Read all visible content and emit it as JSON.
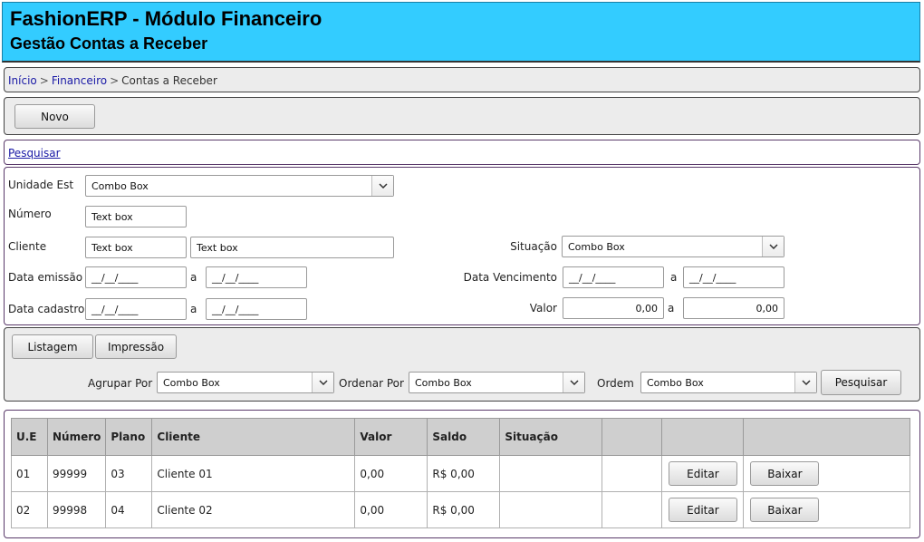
{
  "header": {
    "title": "FashionERP - Módulo Financeiro",
    "subtitle": "Gestão Contas a Receber"
  },
  "breadcrumb": {
    "items": [
      {
        "label": "Início",
        "link": true
      },
      {
        "label": "Financeiro",
        "link": true
      },
      {
        "label": "Contas a Receber",
        "link": false
      }
    ],
    "separator": ">"
  },
  "toolbar": {
    "new_label": "Novo"
  },
  "search_toggle": {
    "label": "Pesquisar"
  },
  "filters": {
    "unidade": {
      "label": "Unidade Est",
      "value": "Combo Box"
    },
    "numero": {
      "label": "Número",
      "value": "Text box"
    },
    "cliente": {
      "label": "Cliente",
      "code_value": "Text box",
      "name_value": "Text box"
    },
    "situacao": {
      "label": "Situação",
      "value": "Combo Box"
    },
    "data_emissao": {
      "label": "Data emissão",
      "from": "__/__/____",
      "sep": "a",
      "to": "__/__/____"
    },
    "data_vencimento": {
      "label": "Data Vencimento",
      "from": "__/__/____",
      "sep": "a",
      "to": "__/__/____"
    },
    "data_cadastro": {
      "label": "Data cadastro",
      "from": "__/__/____",
      "sep": "a",
      "to": "__/__/____"
    },
    "valor": {
      "label": "Valor",
      "from": "0,00",
      "sep": "a",
      "to": "0,00"
    }
  },
  "actions": {
    "listagem_label": "Listagem",
    "impressao_label": "Impressão",
    "agrupar": {
      "label": "Agrupar Por",
      "value": "Combo Box"
    },
    "ordenar": {
      "label": "Ordenar Por",
      "value": "Combo Box"
    },
    "ordem": {
      "label": "Ordem",
      "value": "Combo Box"
    },
    "search_label": "Pesquisar"
  },
  "results": {
    "columns": [
      "U.E",
      "Número",
      "Plano",
      "Cliente",
      "Valor",
      "Saldo",
      "Situação",
      "",
      "",
      ""
    ],
    "rows": [
      {
        "ue": "01",
        "numero": "99999",
        "plano": "03",
        "cliente": "Cliente 01",
        "valor": "0,00",
        "saldo": "R$ 0,00",
        "situacao": "",
        "edit_label": "Editar",
        "baixar_label": "Baixar"
      },
      {
        "ue": "02",
        "numero": "99998",
        "plano": "04",
        "cliente": "Cliente 02",
        "valor": "0,00",
        "saldo": "R$ 0,00",
        "situacao": "",
        "edit_label": "Editar",
        "baixar_label": "Baixar"
      }
    ]
  },
  "icons": {
    "combo_arrow": "chevron-down-icon"
  },
  "colors": {
    "header_bg": "#33ccff",
    "link": "#1a1aa6",
    "panel_bg": "#ececec",
    "table_header_bg": "#cfcfcf"
  }
}
